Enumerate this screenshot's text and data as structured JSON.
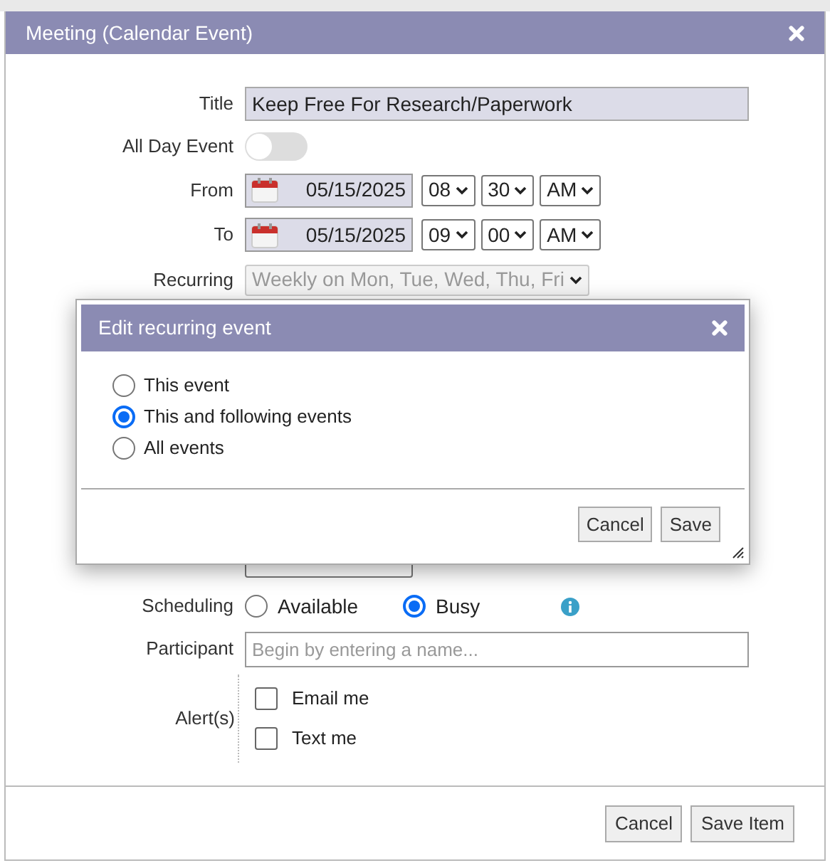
{
  "window": {
    "title": "Meeting (Calendar Event)"
  },
  "form": {
    "title": {
      "label": "Title",
      "value": "Keep Free For Research/Paperwork"
    },
    "all_day": {
      "label": "All Day Event",
      "on": false
    },
    "from": {
      "label": "From",
      "date": "05/15/2025",
      "hour": "08",
      "minute": "30",
      "ampm": "AM"
    },
    "to": {
      "label": "To",
      "date": "05/15/2025",
      "hour": "09",
      "minute": "00",
      "ampm": "AM"
    },
    "recurring": {
      "label": "Recurring",
      "value": "Weekly on Mon, Tue, Wed, Thu, Fri",
      "disabled": true
    },
    "scheduling": {
      "label": "Scheduling",
      "options": [
        {
          "label": "Available",
          "selected": false
        },
        {
          "label": "Busy",
          "selected": true
        }
      ]
    },
    "participant": {
      "label": "Participant",
      "placeholder": "Begin by entering a name..."
    },
    "alerts": {
      "label": "Alert(s)",
      "options": [
        {
          "label": "Email me",
          "checked": false
        },
        {
          "label": "Text me",
          "checked": false
        }
      ]
    }
  },
  "buttons": [
    "Cancel",
    "Save Item"
  ],
  "dialog": {
    "title": "Edit recurring event",
    "options": [
      {
        "label": "This event",
        "selected": false
      },
      {
        "label": "This and following events",
        "selected": true
      },
      {
        "label": "All events",
        "selected": false
      }
    ],
    "buttons": [
      "Cancel",
      "Save"
    ]
  }
}
